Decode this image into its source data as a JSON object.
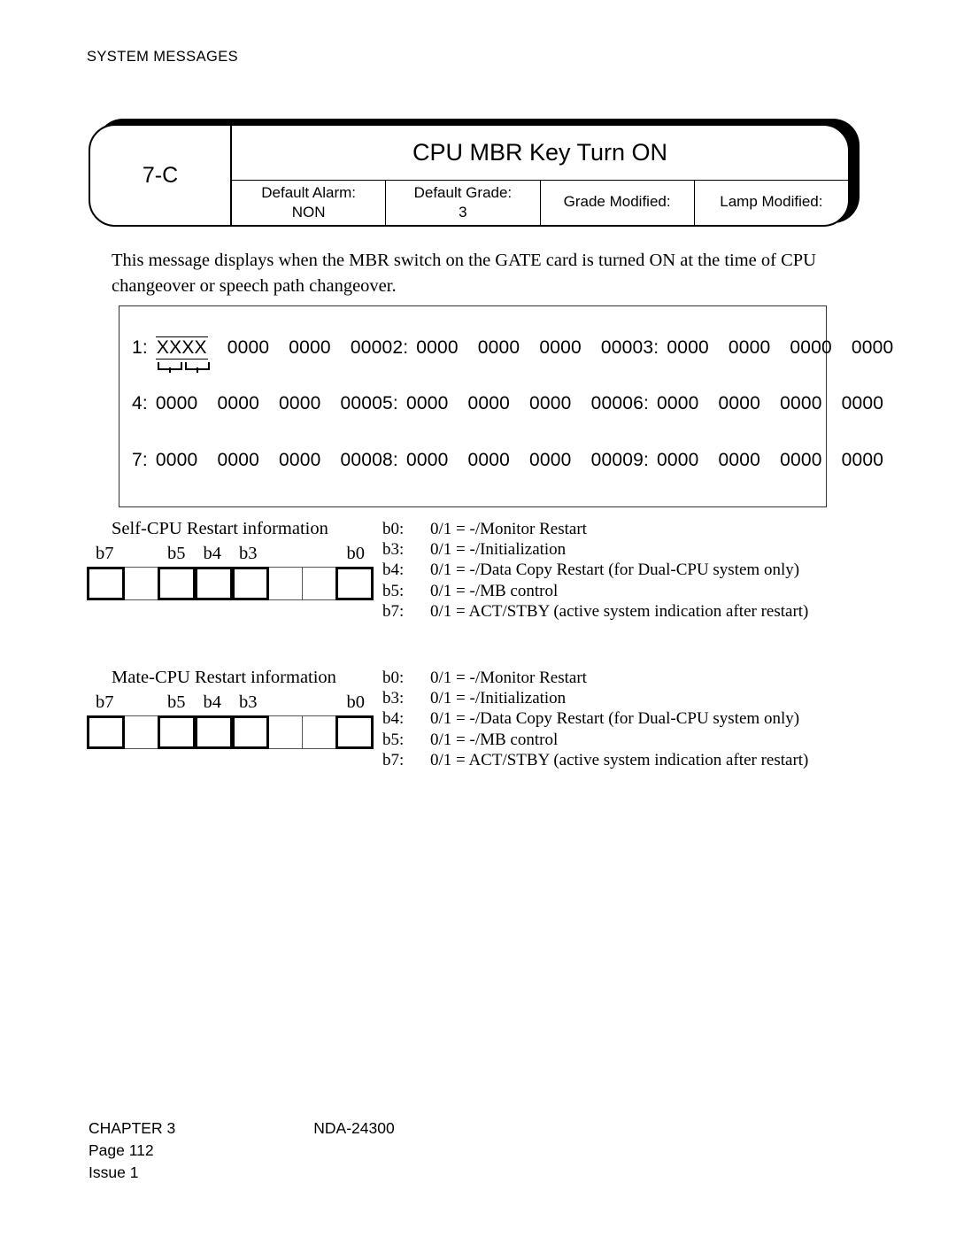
{
  "running_head": "SYSTEM MESSAGES",
  "banner": {
    "code": "7-C",
    "title": "CPU MBR Key Turn ON",
    "attributes": [
      {
        "label": "Default Alarm:",
        "value": "NON"
      },
      {
        "label": "Default Grade:",
        "value": "3"
      },
      {
        "label": "Grade Modified:",
        "value": ""
      },
      {
        "label": "Lamp Modified:",
        "value": ""
      }
    ]
  },
  "description": "This message displays when the MBR switch on the GATE card is turned ON at the time of CPU changeover or speech path changeover.",
  "data_box": {
    "rows": [
      {
        "groups": [
          {
            "index": "1:",
            "words": [
              "XXXX",
              "0000",
              "0000",
              "0000"
            ],
            "highlight_first": true
          },
          {
            "index": "2:",
            "words": [
              "0000",
              "0000",
              "0000",
              "0000"
            ],
            "highlight_first": false
          },
          {
            "index": "3:",
            "words": [
              "0000",
              "0000",
              "0000",
              "0000"
            ],
            "highlight_first": false
          }
        ]
      },
      {
        "groups": [
          {
            "index": "4:",
            "words": [
              "0000",
              "0000",
              "0000",
              "0000"
            ],
            "highlight_first": false
          },
          {
            "index": "5:",
            "words": [
              "0000",
              "0000",
              "0000",
              "0000"
            ],
            "highlight_first": false
          },
          {
            "index": "6:",
            "words": [
              "0000",
              "0000",
              "0000",
              "0000"
            ],
            "highlight_first": false
          }
        ]
      },
      {
        "groups": [
          {
            "index": "7:",
            "words": [
              "0000",
              "0000",
              "0000",
              "0000"
            ],
            "highlight_first": false
          },
          {
            "index": "8:",
            "words": [
              "0000",
              "0000",
              "0000",
              "0000"
            ],
            "highlight_first": false
          },
          {
            "index": "9:",
            "words": [
              "0000",
              "0000",
              "0000",
              "0000"
            ],
            "highlight_first": false
          }
        ]
      }
    ]
  },
  "bit_sections": [
    {
      "title": "Self-CPU Restart information",
      "bit_labels": [
        {
          "text": "b7",
          "cell": 0
        },
        {
          "text": "b5",
          "cell": 2
        },
        {
          "text": "b4",
          "cell": 3
        },
        {
          "text": "b3",
          "cell": 4
        },
        {
          "text": "b0",
          "cell": 7
        }
      ],
      "bold_cells": [
        0,
        2,
        3,
        4,
        7
      ],
      "descriptions": [
        {
          "bit": "b0:",
          "text": "0/1 = -/Monitor Restart"
        },
        {
          "bit": "b3:",
          "text": "0/1 = -/Initialization"
        },
        {
          "bit": "b4:",
          "text": "0/1 = -/Data Copy Restart (for Dual-CPU system only)"
        },
        {
          "bit": "b5:",
          "text": "0/1 = -/MB control"
        },
        {
          "bit": "b7:",
          "text": "0/1 = ACT/STBY (active system indication after restart)"
        }
      ]
    },
    {
      "title": "Mate-CPU Restart information",
      "bit_labels": [
        {
          "text": "b7",
          "cell": 0
        },
        {
          "text": "b5",
          "cell": 2
        },
        {
          "text": "b4",
          "cell": 3
        },
        {
          "text": "b3",
          "cell": 4
        },
        {
          "text": "b0",
          "cell": 7
        }
      ],
      "bold_cells": [
        0,
        2,
        3,
        4,
        7
      ],
      "descriptions": [
        {
          "bit": "b0:",
          "text": "0/1 = -/Monitor Restart"
        },
        {
          "bit": "b3:",
          "text": "0/1 = -/Initialization"
        },
        {
          "bit": "b4:",
          "text": "0/1 = -/Data Copy Restart (for Dual-CPU system only)"
        },
        {
          "bit": "b5:",
          "text": "0/1 = -/MB control"
        },
        {
          "bit": "b7:",
          "text": "0/1 = ACT/STBY (active system indication after restart)"
        }
      ]
    }
  ],
  "footer": {
    "chapter": "CHAPTER 3",
    "document": "NDA-24300",
    "page": "Page 112",
    "issue": "Issue 1"
  }
}
